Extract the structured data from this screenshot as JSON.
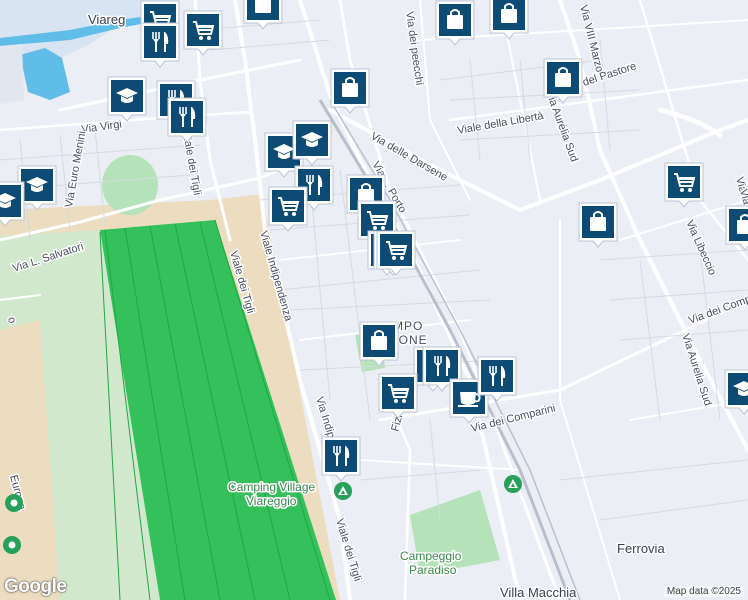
{
  "map": {
    "labels": {
      "viareggio": "Viareg",
      "via_virgilio": "Via Virgi",
      "via_euro_menini": "Via Euro Menini",
      "via_l_salvatori": "Via L. Salvatori",
      "viale_dei_tigli_top": "Viale dei Tigli",
      "viale_indipendenza": "Viale Indipendenza",
      "via_indipendenza": "Via Indipe",
      "viale_dei_tigli_bottom": "Viale dei Tigli",
      "via_delle_darsene": "Via delle Darsene",
      "via_dei_peecchi": "Via dei peecchi",
      "via_viii_marzo": "Via VIII Marzo",
      "via_del_pastore": "del Pastore",
      "viale_della_liberta": "Viale della Libertà",
      "via_aurelia_sud_top": "Via Aurelia Sud",
      "via_aurelia_sud_right": "Via Aurelia Sud",
      "via_libeccio": "Via Libeccio",
      "via_dei_comparini_right": "Via dei Compari",
      "via_dei_comparini": "Via dei Comparini",
      "via_fizi": "Fizi",
      "via_del_porto": "Via ... Porto",
      "campo_a": "MPO",
      "campo_b": "ZIONE",
      "europa": "Europa",
      "campo_left": "o",
      "ferrovia": "Ferrovia",
      "villa_macchia": "Villa Macchia",
      "camping_village_1": "Camping Village",
      "camping_village_2": "Viareggio",
      "campeggio_1": "Campeggio",
      "campeggio_2": "Paradiso",
      "via_u": "Via U",
      "via_s": "Via S"
    },
    "markers": [
      {
        "icon": "cart-icon"
      },
      {
        "icon": "cart-icon"
      },
      {
        "icon": "restaurant-icon"
      },
      {
        "icon": "shopping-bag-icon"
      },
      {
        "icon": "shopping-bag-icon"
      },
      {
        "icon": "shopping-bag-icon"
      },
      {
        "icon": "shopping-bag-icon"
      },
      {
        "icon": "school-icon"
      },
      {
        "icon": "restaurant-icon"
      },
      {
        "icon": "restaurant-icon"
      },
      {
        "icon": "school-icon"
      },
      {
        "icon": "school-icon"
      },
      {
        "icon": "school-icon"
      },
      {
        "icon": "school-icon"
      },
      {
        "icon": "restaurant-icon"
      },
      {
        "icon": "cart-icon"
      },
      {
        "icon": "shopping-bag-icon"
      },
      {
        "icon": "cart-icon"
      },
      {
        "icon": "cart-icon"
      },
      {
        "icon": "cart-icon"
      },
      {
        "icon": "shopping-bag-icon"
      },
      {
        "icon": "restaurant-icon"
      },
      {
        "icon": "restaurant-icon"
      },
      {
        "icon": "cart-icon"
      },
      {
        "icon": "coffee-icon"
      },
      {
        "icon": "restaurant-icon"
      },
      {
        "icon": "shopping-bag-icon"
      },
      {
        "icon": "cart-icon"
      },
      {
        "icon": "shopping-bag-icon"
      },
      {
        "icon": "school-icon"
      },
      {
        "icon": "restaurant-icon"
      },
      {
        "icon": "shopping-bag-icon"
      },
      {
        "icon": "cart-icon"
      }
    ],
    "attribution": "Map data ©2025",
    "google_logo": "Google"
  }
}
